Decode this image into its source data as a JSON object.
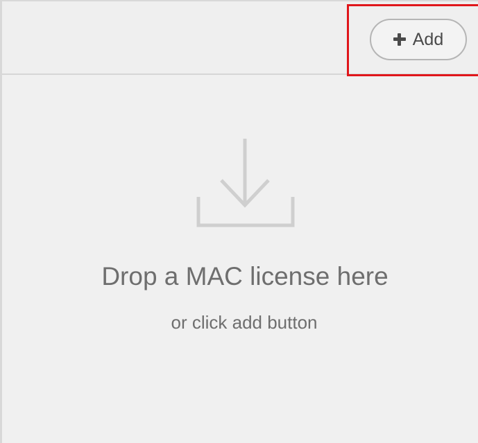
{
  "toolbar": {
    "add_label": "Add",
    "add_icon": "plus-icon"
  },
  "dropzone": {
    "icon": "download-tray-icon",
    "title": "Drop a MAC license here",
    "subtitle": "or click add button"
  },
  "colors": {
    "highlight_border": "#e0161b",
    "background": "#f0f0f0",
    "icon": "#cfcfcf",
    "text": "#6e6e6e"
  }
}
